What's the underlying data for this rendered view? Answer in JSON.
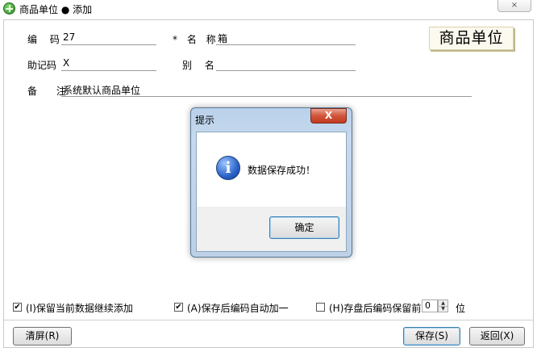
{
  "window": {
    "title": "商品单位 ● 添加",
    "close_symbol": "×"
  },
  "form": {
    "code_label": "编 码",
    "code_value": "27",
    "name_label": "* 名 称",
    "name_value": "箱",
    "mnemonic_label": "助记码",
    "mnemonic_value": "X",
    "alias_label": "别 名",
    "alias_value": "",
    "remark_label": "备 注",
    "remark_value": "系统默认商品单位",
    "logo_text": "商品单位"
  },
  "options": {
    "keep_data_label": "(I)保留当前数据继续添加",
    "keep_data_checked": true,
    "auto_increment_label": "(A)保存后编码自动加一",
    "auto_increment_checked": true,
    "keep_code_label": "(H)存盘后编码保留前",
    "keep_code_checked": false,
    "keep_code_digits": "0",
    "digits_unit": "位"
  },
  "buttons": {
    "clear_label": "清屏(R)",
    "save_label": "保存(S)",
    "back_label": "返回(X)"
  },
  "dialog": {
    "title": "提示",
    "close_symbol": "X",
    "icon_glyph": "i",
    "message": "数据保存成功！",
    "ok_label": "确定"
  },
  "glyphs": {
    "check": "✔",
    "spin_up": "▲",
    "spin_down": "▼"
  }
}
